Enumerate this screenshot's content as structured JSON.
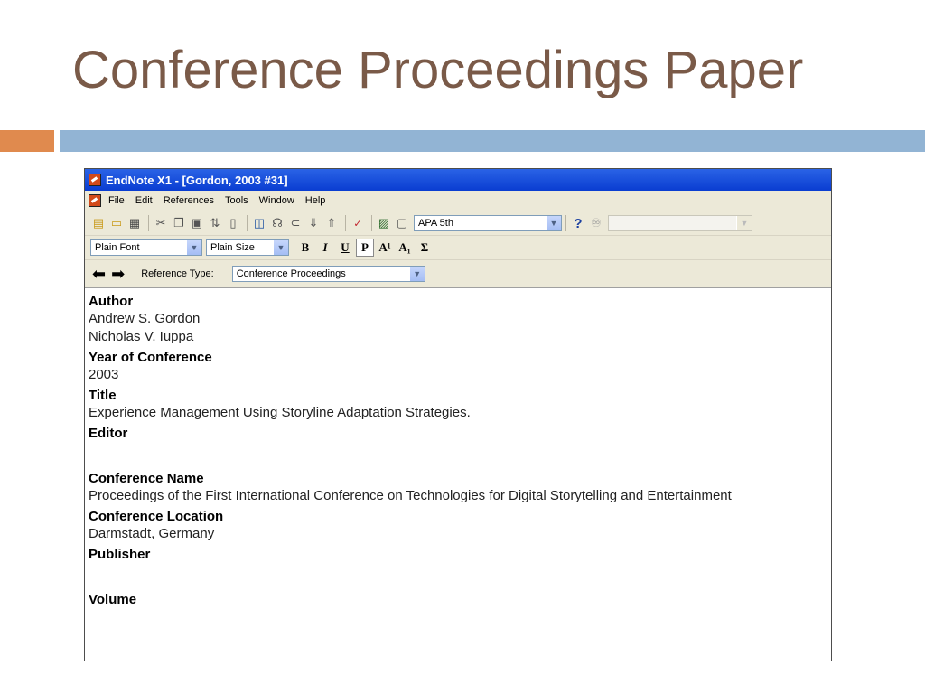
{
  "slide": {
    "title": "Conference Proceedings Paper"
  },
  "window": {
    "title": "EndNote X1 - [Gordon, 2003 #31]",
    "menu": [
      "File",
      "Edit",
      "References",
      "Tools",
      "Window",
      "Help"
    ],
    "style_select": "APA 5th",
    "font_select": "Plain Font",
    "size_select": "Plain Size",
    "format_buttons": {
      "bold": "B",
      "italic": "I",
      "underline": "U",
      "plain": "P",
      "superscript": "A¹",
      "subscript": "A₁",
      "symbol": "Σ"
    },
    "reference_type_label": "Reference Type:",
    "reference_type_value": "Conference Proceedings"
  },
  "fields": [
    {
      "label": "Author",
      "values": [
        "Andrew S. Gordon",
        "Nicholas V. Iuppa"
      ]
    },
    {
      "label": "Year of Conference",
      "values": [
        "2003"
      ]
    },
    {
      "label": "Title",
      "values": [
        "Experience Management Using Storyline Adaptation Strategies."
      ]
    },
    {
      "label": "Editor",
      "values": []
    },
    {
      "label": "Conference Name",
      "values": [
        "Proceedings of the First International Conference on Technologies for Digital Storytelling and Entertainment"
      ]
    },
    {
      "label": "Conference Location",
      "values": [
        "Darmstadt, Germany"
      ]
    },
    {
      "label": "Publisher",
      "values": []
    },
    {
      "label": "Volume",
      "values": []
    }
  ],
  "colors": {
    "title": "#7a5a48",
    "accent_orange": "#e08a4e",
    "accent_blue": "#92b4d4",
    "titlebar": "#0a3dd1"
  },
  "icons": [
    "new-reference-icon",
    "open-icon",
    "print-icon",
    "cut-icon",
    "copy-icon",
    "paste-icon",
    "sort-icon",
    "preview-icon",
    "find-icon",
    "link-icon",
    "attach-icon",
    "spell-check-icon",
    "image-icon",
    "help-icon",
    "binoculars-icon",
    "back-arrow-icon",
    "forward-arrow-icon"
  ]
}
